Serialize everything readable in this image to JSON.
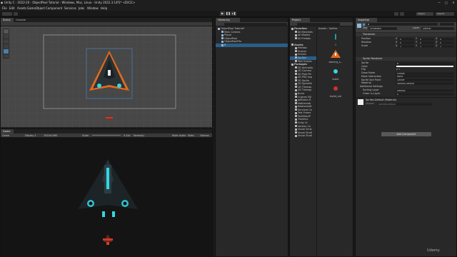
{
  "window": {
    "title": "Unity C - 2022-20 - ObjectPool Tutorial - Windows, Mac, Linux - Unity 2022.3.14f1* <DX11>",
    "controls": [
      "—",
      "□",
      "✕"
    ]
  },
  "menu": [
    "File",
    "Edit",
    "Assets",
    "GameObject",
    "Component",
    "Services",
    "Jobs",
    "Window",
    "Help"
  ],
  "toolbar": {
    "right": [
      "Layers",
      "Layout"
    ]
  },
  "scene": {
    "tabs": [
      "Scene",
      "Console"
    ]
  },
  "game": {
    "tabs": [
      "Game"
    ],
    "mode": "Game",
    "display": "Display 1",
    "resolution": "1920x1080",
    "scale_label": "Scale",
    "scale_value": "0.43x",
    "playfocus": "Normally",
    "mute": "Mute Audio",
    "stats": "Stats",
    "gizmos": "Gizmos"
  },
  "hierarchy": {
    "tab": "Hierarchy",
    "items": [
      {
        "label": "ObjectPool Tutorial*",
        "indent": 0,
        "kind": "scene"
      },
      {
        "label": "Main Camera",
        "indent": 1,
        "kind": "cube"
      },
      {
        "label": "Player",
        "indent": 1,
        "kind": "cube"
      },
      {
        "label": "ObjectPool",
        "indent": 1,
        "kind": "cube"
      },
      {
        "label": "ObjectPoolFifo",
        "indent": 1,
        "kind": "cube"
      },
      {
        "label": "B",
        "indent": 1,
        "kind": "cube",
        "selected": true
      }
    ]
  },
  "project": {
    "tab": "Project",
    "tree": [
      {
        "label": "Favorites",
        "indent": 0,
        "bold": true
      },
      {
        "label": "All Materials",
        "indent": 1
      },
      {
        "label": "All Models",
        "indent": 1
      },
      {
        "label": "All Prefabs",
        "indent": 1
      },
      {
        "label": "",
        "indent": 0
      },
      {
        "label": "Assets",
        "indent": 0,
        "bold": true
      },
      {
        "label": "Prefabs",
        "indent": 1
      },
      {
        "label": "Scenes",
        "indent": 1
      },
      {
        "label": "Scripts",
        "indent": 1
      },
      {
        "label": "Sprites",
        "indent": 1,
        "selected": true
      },
      {
        "label": "Text Scripts",
        "indent": 1
      },
      {
        "label": "Packages",
        "indent": 0,
        "bold": true
      },
      {
        "label": "2D Animatio",
        "indent": 1
      },
      {
        "label": "2D Commo",
        "indent": 1
      },
      {
        "label": "2D Pixel Pe",
        "indent": 1
      },
      {
        "label": "2D PSD Imp",
        "indent": 1
      },
      {
        "label": "2D Sprite",
        "indent": 1
      },
      {
        "label": "2D SpriteSh",
        "indent": 1
      },
      {
        "label": "2D Tilemap",
        "indent": 1
      },
      {
        "label": "2D Tilemap",
        "indent": 1
      },
      {
        "label": "Burst",
        "indent": 1
      },
      {
        "label": "Custom NU",
        "indent": 1
      },
      {
        "label": "JetBrains R",
        "indent": 1
      },
      {
        "label": "Mathemati",
        "indent": 1
      },
      {
        "label": "Newtonsoft",
        "indent": 1
      },
      {
        "label": "Services Co",
        "indent": 1
      },
      {
        "label": "Test Frame",
        "indent": 1
      },
      {
        "label": "TextMeshP",
        "indent": 1
      },
      {
        "label": "Timeline",
        "indent": 1
      },
      {
        "label": "Unity UI",
        "indent": 1
      },
      {
        "label": "Version Co",
        "indent": 1
      },
      {
        "label": "Visual Scrip",
        "indent": 1
      },
      {
        "label": "Visual Studi",
        "indent": 1
      },
      {
        "label": "Visual Studi",
        "indent": 1
      }
    ],
    "breadcrumb": [
      "Assets",
      "Sprites"
    ],
    "assets": [
      "1",
      "warning_s...",
      "bullet",
      "bullet_red"
    ]
  },
  "inspector": {
    "tab": "Inspector",
    "object_name": "B",
    "tag_label": "Tag",
    "tag": "Untagged",
    "layer_label": "Layer",
    "layer": "Default",
    "transform": {
      "title": "Transform",
      "rows": [
        {
          "label": "Position",
          "x": "0",
          "y": "0",
          "z": "0"
        },
        {
          "label": "Rotation",
          "x": "0",
          "y": "0",
          "z": "0"
        },
        {
          "label": "Scale",
          "x": "1",
          "y": "1",
          "z": "1"
        }
      ]
    },
    "sprite_renderer": {
      "title": "Sprite Renderer",
      "rows": [
        {
          "label": "Sprite",
          "value": "B"
        },
        {
          "label": "Color",
          "value": ""
        },
        {
          "label": "Flip",
          "value": "X   Y"
        },
        {
          "label": "Draw Mode",
          "value": "Simple"
        },
        {
          "label": "Mask Interaction",
          "value": "None"
        },
        {
          "label": "Sprite Sort Point",
          "value": "Center"
        },
        {
          "label": "Material",
          "value": "Sprites-Default"
        }
      ],
      "additional": "Additional Settings",
      "sorting_layer_label": "Sorting Layer",
      "sorting_layer": "Default",
      "order_label": "Order in Layer",
      "order": "0"
    },
    "material": {
      "name": "Sprites-Default (Material)",
      "shader_label": "Shader",
      "shader": "Sprites/Default"
    },
    "add_component": "Add Component"
  },
  "watermark": "Udemy",
  "colors": {
    "accent": "#2c5d87",
    "orange": "#e06a1e",
    "cyan": "#34d6e0"
  }
}
